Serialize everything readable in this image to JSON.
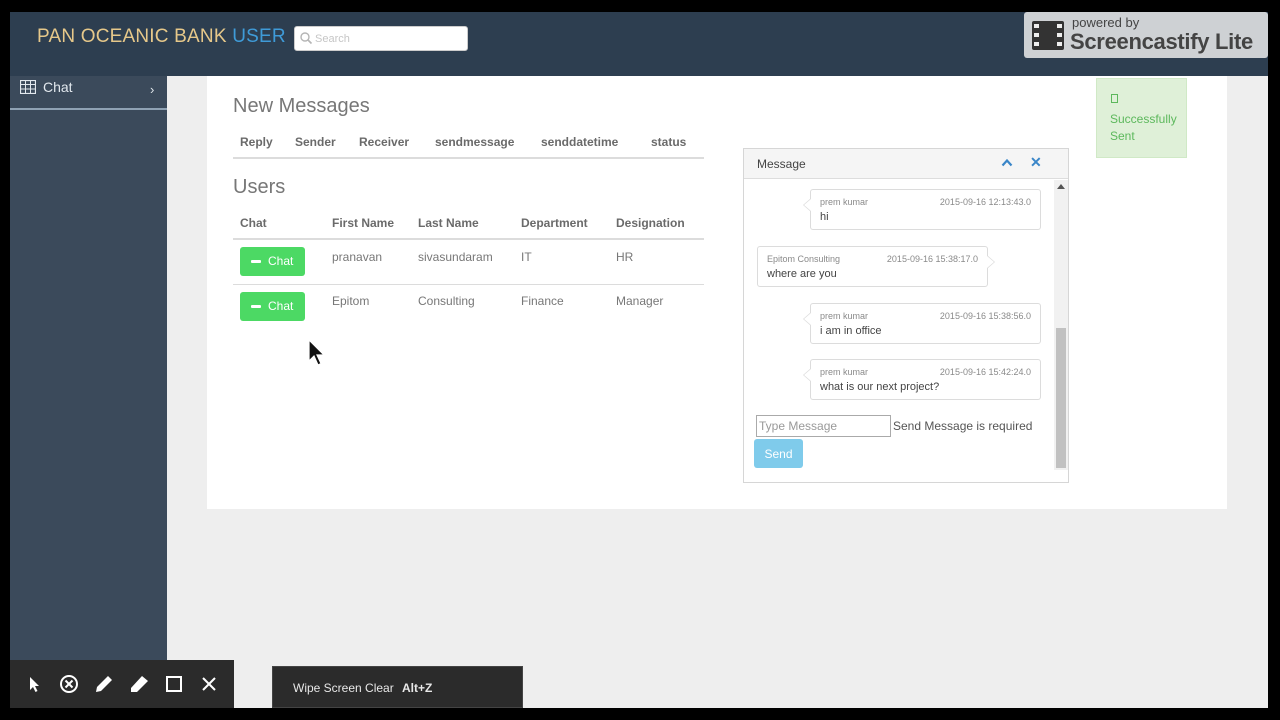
{
  "navbar": {
    "brand_main": "PAN OCEANIC BANK",
    "brand_accent": "USER",
    "search_placeholder": "Search"
  },
  "watermark": {
    "small_text": "powered by",
    "big_text": "Screencastify Lite"
  },
  "sidebar": {
    "items": [
      {
        "label": "Chat",
        "icon": "table-grid-icon",
        "chevron": "›"
      }
    ]
  },
  "new_messages": {
    "title": "New Messages",
    "columns": [
      "Reply",
      "Sender",
      "Receiver",
      "sendmessage",
      "senddatetime",
      "status"
    ]
  },
  "users": {
    "title": "Users",
    "columns": [
      "Chat",
      "First Name",
      "Last Name",
      "Department",
      "Designation"
    ],
    "rows": [
      {
        "button": "Chat",
        "first_name": "pranavan",
        "last_name": "sivasundaram",
        "department": "IT",
        "designation": "HR"
      },
      {
        "button": "Chat",
        "first_name": "Epitom",
        "last_name": "Consulting",
        "department": "Finance",
        "designation": "Manager"
      }
    ]
  },
  "toast": {
    "text": "Successfully Sent",
    "color": "#5cb85c"
  },
  "message_panel": {
    "title": "Message",
    "messages": [
      {
        "sender": "prem kumar",
        "datetime": "2015-09-16 12:13:43.0",
        "text": "hi",
        "side": "right"
      },
      {
        "sender": "Epitom Consulting",
        "datetime": "2015-09-16 15:38:17.0",
        "text": "where are you",
        "side": "left"
      },
      {
        "sender": "prem kumar",
        "datetime": "2015-09-16 15:38:56.0",
        "text": "i am in office",
        "side": "right"
      },
      {
        "sender": "prem kumar",
        "datetime": "2015-09-16 15:42:24.0",
        "text": "what is our next project?",
        "side": "right"
      }
    ],
    "input_placeholder": "Type Message",
    "validation_text": "Send Message is required",
    "send_label": "Send"
  },
  "bottom_toolbar": {
    "tools": [
      "pointer-icon",
      "eraser-circle-icon",
      "pen-icon",
      "highlighter-icon",
      "rectangle-icon",
      "close-icon"
    ],
    "wipe_label": "Wipe Screen Clear",
    "wipe_shortcut": "Alt+Z"
  },
  "colors": {
    "navbar_bg": "#2d3e50",
    "brand_gold": "#e6c88a",
    "brand_blue": "#3f9bd8",
    "sidebar_bg": "#3b4a5b",
    "chat_button_green": "#4cd964",
    "send_button_blue": "#7fcbeb"
  }
}
